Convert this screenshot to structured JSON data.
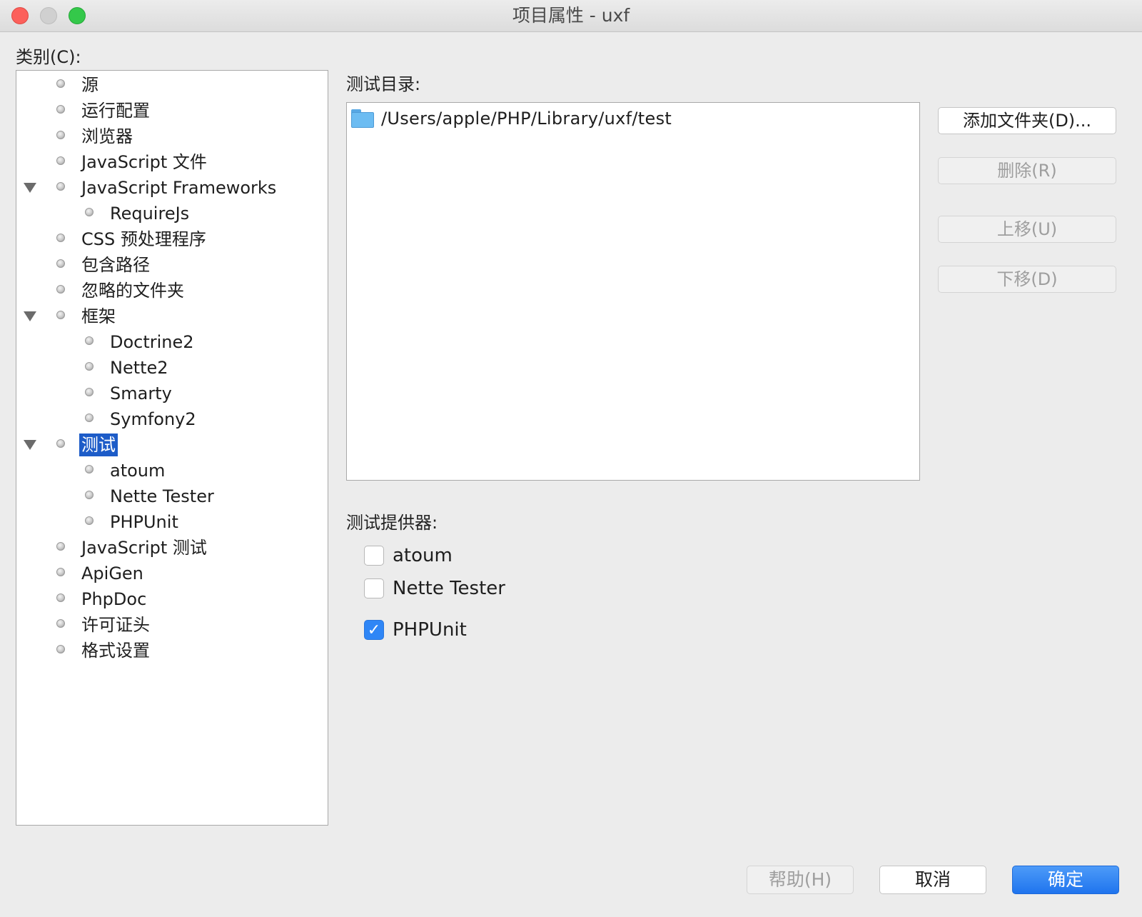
{
  "window": {
    "title": "项目属性 - uxf"
  },
  "categories": {
    "label": "类别(C):",
    "items": [
      {
        "label": "源",
        "level": 0,
        "expanded": false,
        "has_children": false,
        "selected": false
      },
      {
        "label": "运行配置",
        "level": 0,
        "has_children": false,
        "selected": false
      },
      {
        "label": "浏览器",
        "level": 0,
        "has_children": false,
        "selected": false
      },
      {
        "label": "JavaScript 文件",
        "level": 0,
        "has_children": false,
        "selected": false
      },
      {
        "label": "JavaScript Frameworks",
        "level": 0,
        "has_children": true,
        "expanded": true,
        "selected": false
      },
      {
        "label": "RequireJs",
        "level": 1,
        "has_children": false,
        "selected": false
      },
      {
        "label": "CSS 预处理程序",
        "level": 0,
        "has_children": false,
        "selected": false
      },
      {
        "label": "包含路径",
        "level": 0,
        "has_children": false,
        "selected": false
      },
      {
        "label": "忽略的文件夹",
        "level": 0,
        "has_children": false,
        "selected": false
      },
      {
        "label": "框架",
        "level": 0,
        "has_children": true,
        "expanded": true,
        "selected": false
      },
      {
        "label": "Doctrine2",
        "level": 1,
        "has_children": false,
        "selected": false
      },
      {
        "label": "Nette2",
        "level": 1,
        "has_children": false,
        "selected": false
      },
      {
        "label": "Smarty",
        "level": 1,
        "has_children": false,
        "selected": false
      },
      {
        "label": "Symfony2",
        "level": 1,
        "has_children": false,
        "selected": false
      },
      {
        "label": "测试",
        "level": 0,
        "has_children": true,
        "expanded": true,
        "selected": true
      },
      {
        "label": "atoum",
        "level": 1,
        "has_children": false,
        "selected": false
      },
      {
        "label": "Nette Tester",
        "level": 1,
        "has_children": false,
        "selected": false
      },
      {
        "label": "PHPUnit",
        "level": 1,
        "has_children": false,
        "selected": false
      },
      {
        "label": "JavaScript 测试",
        "level": 0,
        "has_children": false,
        "selected": false
      },
      {
        "label": "ApiGen",
        "level": 0,
        "has_children": false,
        "selected": false
      },
      {
        "label": "PhpDoc",
        "level": 0,
        "has_children": false,
        "selected": false
      },
      {
        "label": "许可证头",
        "level": 0,
        "has_children": false,
        "selected": false
      },
      {
        "label": "格式设置",
        "level": 0,
        "has_children": false,
        "selected": false
      }
    ]
  },
  "test_dirs": {
    "label": "测试目录:",
    "items": [
      {
        "path": "/Users/apple/PHP/Library/uxf/test",
        "icon": "folder-icon"
      }
    ],
    "buttons": {
      "add": "添加文件夹(D)...",
      "remove": "删除(R)",
      "up": "上移(U)",
      "down": "下移(D)"
    }
  },
  "providers": {
    "label": "测试提供器:",
    "items": [
      {
        "label": "atoum",
        "checked": false
      },
      {
        "label": "Nette Tester",
        "checked": false
      },
      {
        "label": "PHPUnit",
        "checked": true
      }
    ]
  },
  "footer": {
    "help": "帮助(H)",
    "cancel": "取消",
    "ok": "确定"
  },
  "colors": {
    "selection": "#1d5cc8",
    "primary_button": "#1f74ee",
    "checkbox_checked": "#2f86f6",
    "folder": "#6cbcf2"
  }
}
